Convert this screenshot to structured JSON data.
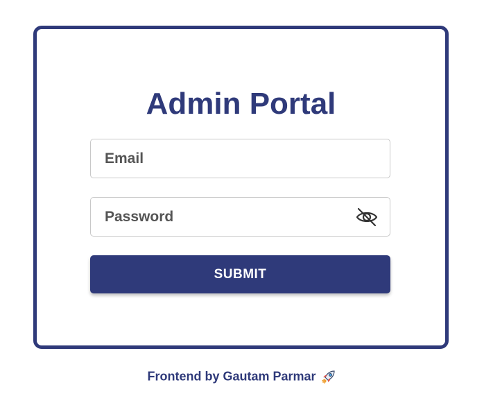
{
  "login_card": {
    "title": "Admin Portal",
    "email": {
      "placeholder": "Email",
      "value": ""
    },
    "password": {
      "placeholder": "Password",
      "value": "",
      "toggle_icon": "eye-off-icon"
    },
    "submit_label": "SUBMIT"
  },
  "footer": {
    "credit": "Frontend by Gautam Parmar",
    "icon": "rocket-icon"
  },
  "colors": {
    "primary": "#2f3a7a",
    "field_border": "#c8c8c8",
    "placeholder_text": "#555555",
    "background": "#ffffff"
  }
}
